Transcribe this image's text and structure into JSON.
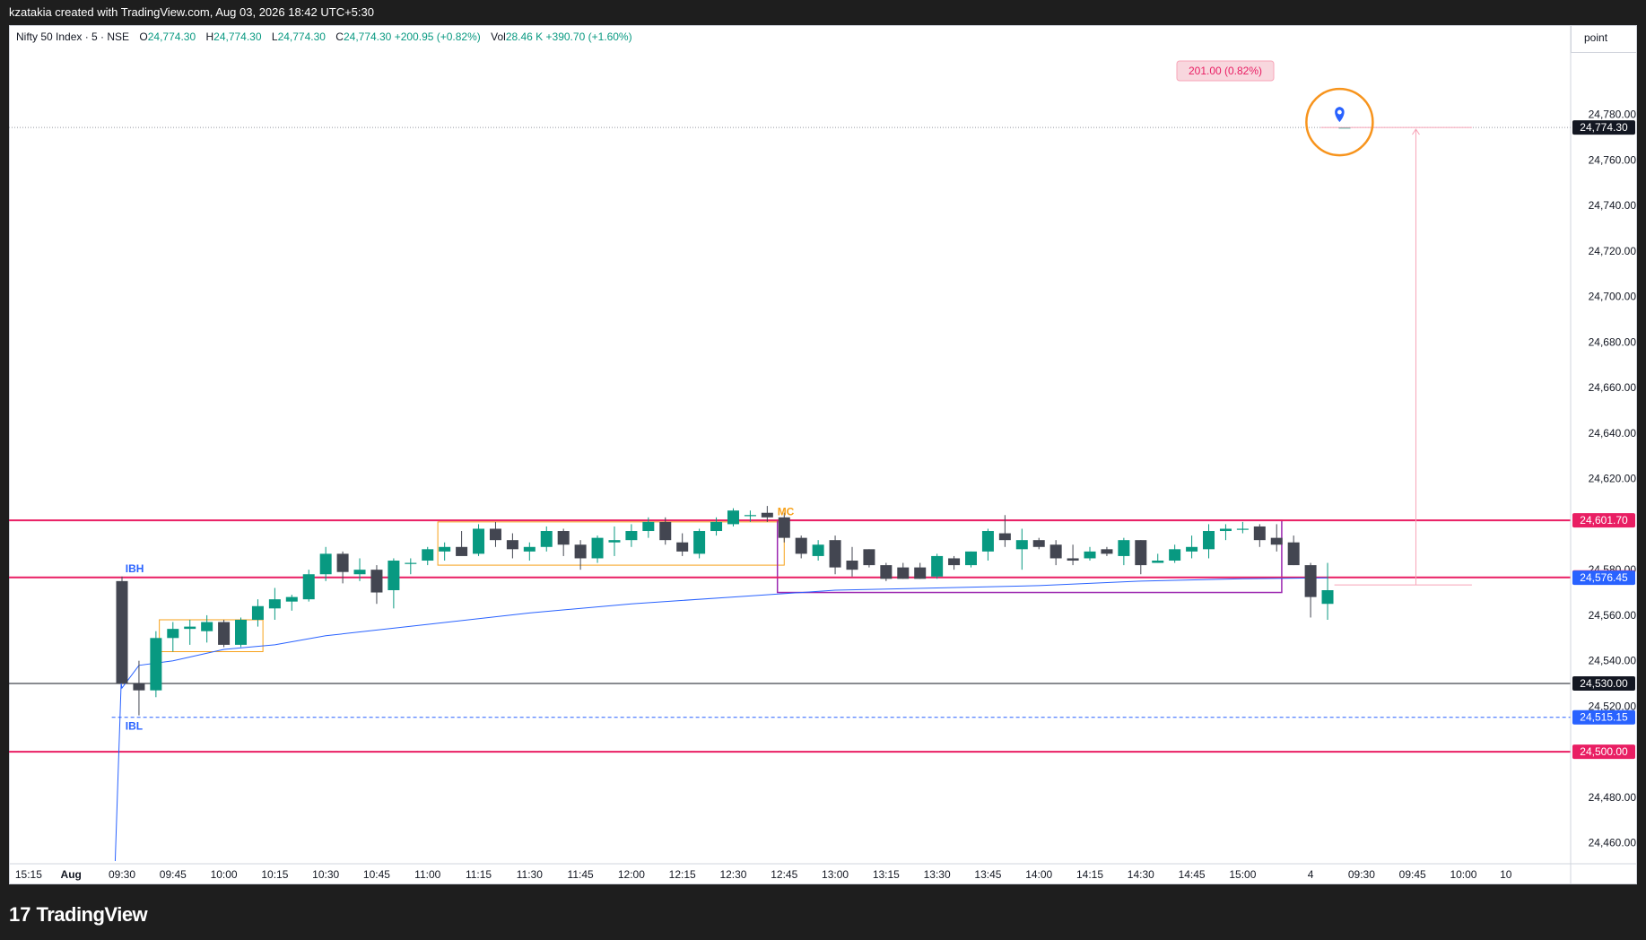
{
  "header": {
    "caption": "kzatakia created with TradingView.com, Aug 03, 2026 18:42 UTC+5:30"
  },
  "legend": {
    "symbol": "Nifty 50 Index · 5 · NSE",
    "o_label": "O",
    "o_val": "24,774.30",
    "h_label": "H",
    "h_val": "24,774.30",
    "l_label": "L",
    "l_val": "24,774.30",
    "c_label": "C",
    "c_val": "24,774.30",
    "change": "+200.95 (+0.82%)",
    "vol_label": "Vol",
    "vol_val": "28.46 K",
    "vol_change": "+390.70 (+1.60%)"
  },
  "price_unit": "point",
  "footer": {
    "brand": "TradingView"
  },
  "colors": {
    "up": "#089981",
    "down": "#434651",
    "magenta": "#e91e63",
    "blue": "#2962ff",
    "orange": "#f7a21b",
    "purple": "#9c27b0",
    "vwap": "#2962ff",
    "grid_text": "#131722"
  },
  "chart_data": {
    "type": "candlestick",
    "y_axis": {
      "range": [
        24452,
        24796
      ],
      "ticks": [
        "24,780.00",
        "24,760.00",
        "24,740.00",
        "24,720.00",
        "24,700.00",
        "24,680.00",
        "24,660.00",
        "24,640.00",
        "24,620.00",
        "24,580.00",
        "24,560.00",
        "24,540.00",
        "24,520.00",
        "24,480.00",
        "24,460.00"
      ],
      "tick_values": [
        24780,
        24760,
        24740,
        24720,
        24700,
        24680,
        24660,
        24640,
        24620,
        24580,
        24560,
        24540,
        24520,
        24480,
        24460
      ]
    },
    "x_axis": {
      "labels": [
        "15:00",
        "15:15",
        "Aug",
        "09:30",
        "09:45",
        "10:00",
        "10:15",
        "10:30",
        "10:45",
        "11:00",
        "11:15",
        "11:30",
        "11:45",
        "12:00",
        "12:15",
        "12:30",
        "12:45",
        "13:00",
        "13:15",
        "13:30",
        "13:45",
        "14:00",
        "14:15",
        "14:30",
        "14:45",
        "15:00",
        "4",
        "09:30",
        "09:45",
        "10:00",
        "10"
      ],
      "bold_labels": [
        "Aug"
      ],
      "label_bars": [
        -8.5,
        -5.5,
        -3,
        0,
        3,
        6,
        9,
        12,
        15,
        18,
        21,
        24,
        27,
        30,
        33,
        36,
        39,
        42,
        45,
        48,
        51,
        54,
        57,
        60,
        63,
        66,
        70,
        73,
        76,
        79,
        81.5
      ]
    },
    "candles": [
      {
        "o": 24575,
        "h": 24577,
        "l": 24530,
        "c": 24530
      },
      {
        "o": 24530,
        "h": 24540,
        "l": 24516,
        "c": 24527
      },
      {
        "o": 24527,
        "h": 24553,
        "l": 24524,
        "c": 24550
      },
      {
        "o": 24550,
        "h": 24557,
        "l": 24544,
        "c": 24554
      },
      {
        "o": 24554,
        "h": 24558,
        "l": 24547,
        "c": 24555
      },
      {
        "o": 24553,
        "h": 24560,
        "l": 24548,
        "c": 24557
      },
      {
        "o": 24557,
        "h": 24558,
        "l": 24546,
        "c": 24547
      },
      {
        "o": 24547,
        "h": 24559,
        "l": 24546,
        "c": 24558
      },
      {
        "o": 24558,
        "h": 24567,
        "l": 24555,
        "c": 24564
      },
      {
        "o": 24563,
        "h": 24572,
        "l": 24558,
        "c": 24567
      },
      {
        "o": 24566,
        "h": 24569,
        "l": 24562,
        "c": 24568
      },
      {
        "o": 24567,
        "h": 24580,
        "l": 24566,
        "c": 24578
      },
      {
        "o": 24578,
        "h": 24590,
        "l": 24575,
        "c": 24587
      },
      {
        "o": 24587,
        "h": 24588,
        "l": 24574,
        "c": 24579
      },
      {
        "o": 24578,
        "h": 24585,
        "l": 24575,
        "c": 24580
      },
      {
        "o": 24580,
        "h": 24582,
        "l": 24565,
        "c": 24570
      },
      {
        "o": 24571,
        "h": 24585,
        "l": 24563,
        "c": 24584
      },
      {
        "o": 24583,
        "h": 24585,
        "l": 24578,
        "c": 24583
      },
      {
        "o": 24584,
        "h": 24590,
        "l": 24582,
        "c": 24589
      },
      {
        "o": 24588,
        "h": 24592,
        "l": 24584,
        "c": 24590
      },
      {
        "o": 24590,
        "h": 24597,
        "l": 24587,
        "c": 24586
      },
      {
        "o": 24587,
        "h": 24600,
        "l": 24586,
        "c": 24598
      },
      {
        "o": 24598,
        "h": 24601,
        "l": 24590,
        "c": 24593
      },
      {
        "o": 24593,
        "h": 24596,
        "l": 24585,
        "c": 24589
      },
      {
        "o": 24588,
        "h": 24592,
        "l": 24584,
        "c": 24590
      },
      {
        "o": 24590,
        "h": 24599,
        "l": 24588,
        "c": 24597
      },
      {
        "o": 24597,
        "h": 24598,
        "l": 24586,
        "c": 24591
      },
      {
        "o": 24591,
        "h": 24593,
        "l": 24580,
        "c": 24585
      },
      {
        "o": 24585,
        "h": 24595,
        "l": 24583,
        "c": 24594
      },
      {
        "o": 24592,
        "h": 24599,
        "l": 24586,
        "c": 24593
      },
      {
        "o": 24593,
        "h": 24600,
        "l": 24590,
        "c": 24597
      },
      {
        "o": 24597,
        "h": 24603,
        "l": 24594,
        "c": 24601
      },
      {
        "o": 24601,
        "h": 24603,
        "l": 24591,
        "c": 24593
      },
      {
        "o": 24592,
        "h": 24596,
        "l": 24586,
        "c": 24588
      },
      {
        "o": 24587,
        "h": 24598,
        "l": 24585,
        "c": 24597
      },
      {
        "o": 24597,
        "h": 24603,
        "l": 24595,
        "c": 24601
      },
      {
        "o": 24600,
        "h": 24607,
        "l": 24599,
        "c": 24606
      },
      {
        "o": 24604,
        "h": 24606,
        "l": 24601,
        "c": 24604
      },
      {
        "o": 24605,
        "h": 24608,
        "l": 24601,
        "c": 24603
      },
      {
        "o": 24603,
        "h": 24605,
        "l": 24592,
        "c": 24594
      },
      {
        "o": 24594,
        "h": 24595,
        "l": 24585,
        "c": 24587
      },
      {
        "o": 24586,
        "h": 24593,
        "l": 24584,
        "c": 24591
      },
      {
        "o": 24593,
        "h": 24595,
        "l": 24578,
        "c": 24581
      },
      {
        "o": 24584,
        "h": 24590,
        "l": 24577,
        "c": 24580
      },
      {
        "o": 24589,
        "h": 24589,
        "l": 24581,
        "c": 24582
      },
      {
        "o": 24582,
        "h": 24583,
        "l": 24575,
        "c": 24576
      },
      {
        "o": 24581,
        "h": 24583,
        "l": 24576,
        "c": 24576
      },
      {
        "o": 24581,
        "h": 24583,
        "l": 24576,
        "c": 24576
      },
      {
        "o": 24577,
        "h": 24587,
        "l": 24576,
        "c": 24586
      },
      {
        "o": 24585,
        "h": 24586,
        "l": 24580,
        "c": 24582
      },
      {
        "o": 24582,
        "h": 24588,
        "l": 24581,
        "c": 24588
      },
      {
        "o": 24588,
        "h": 24598,
        "l": 24584,
        "c": 24597
      },
      {
        "o": 24596,
        "h": 24604,
        "l": 24590,
        "c": 24593
      },
      {
        "o": 24589,
        "h": 24598,
        "l": 24580,
        "c": 24593
      },
      {
        "o": 24593,
        "h": 24594,
        "l": 24589,
        "c": 24590
      },
      {
        "o": 24591,
        "h": 24593,
        "l": 24582,
        "c": 24585
      },
      {
        "o": 24585,
        "h": 24591,
        "l": 24582,
        "c": 24584
      },
      {
        "o": 24585,
        "h": 24590,
        "l": 24584,
        "c": 24588
      },
      {
        "o": 24589,
        "h": 24590,
        "l": 24586,
        "c": 24587
      },
      {
        "o": 24586,
        "h": 24594,
        "l": 24582,
        "c": 24593
      },
      {
        "o": 24593,
        "h": 24593,
        "l": 24578,
        "c": 24582
      },
      {
        "o": 24583,
        "h": 24587,
        "l": 24583,
        "c": 24584
      },
      {
        "o": 24584,
        "h": 24591,
        "l": 24583,
        "c": 24589
      },
      {
        "o": 24588,
        "h": 24595,
        "l": 24585,
        "c": 24590
      },
      {
        "o": 24589,
        "h": 24600,
        "l": 24585,
        "c": 24597
      },
      {
        "o": 24597,
        "h": 24600,
        "l": 24593,
        "c": 24598
      },
      {
        "o": 24598,
        "h": 24601,
        "l": 24596,
        "c": 24598
      },
      {
        "o": 24599,
        "h": 24600,
        "l": 24590,
        "c": 24593
      },
      {
        "o": 24594,
        "h": 24600,
        "l": 24588,
        "c": 24591
      },
      {
        "o": 24592,
        "h": 24595,
        "l": 24582,
        "c": 24582
      },
      {
        "o": 24582,
        "h": 24583,
        "l": 24559,
        "c": 24568
      },
      {
        "o": 24565,
        "h": 24583,
        "l": 24558,
        "c": 24571
      },
      {
        "o": 24774.3,
        "h": 24774.3,
        "l": 24774.3,
        "c": 24774.3
      }
    ],
    "vwap": [
      [
        0,
        24528
      ],
      [
        1,
        24538
      ],
      [
        3,
        24540
      ],
      [
        6,
        24545
      ],
      [
        9,
        24547
      ],
      [
        12,
        24551
      ],
      [
        18,
        24556
      ],
      [
        24,
        24561
      ],
      [
        30,
        24565
      ],
      [
        36,
        24568
      ],
      [
        42,
        24571
      ],
      [
        48,
        24572
      ],
      [
        54,
        24573
      ],
      [
        60,
        24575
      ],
      [
        66,
        24576
      ],
      [
        71,
        24576.45
      ]
    ],
    "levels": [
      {
        "name": "upper-band",
        "value": 24601.7,
        "label": "24,601.70",
        "color": "#e91e63"
      },
      {
        "name": "ibh",
        "value": 24576.6,
        "label": "24,576.60",
        "color": "#e91e63"
      },
      {
        "name": "vwap",
        "value": 24576.45,
        "label": "24,576.45",
        "color": "#2962ff"
      },
      {
        "name": "black-line",
        "value": 24530.0,
        "label": "24,530.00",
        "color": "#131722"
      },
      {
        "name": "ibl",
        "value": 24515.15,
        "label": "24,515.15",
        "color": "#2962ff"
      },
      {
        "name": "lower-band",
        "value": 24500.0,
        "label": "24,500.00",
        "color": "#e91e63"
      }
    ],
    "last_price": {
      "value": 24774.3,
      "label": "24,774.30"
    },
    "annotations": {
      "ibh_label": "IBH",
      "ibl_label": "IBL",
      "mc_label": "MC",
      "measure_label": "201.00 (0.82%)"
    }
  }
}
